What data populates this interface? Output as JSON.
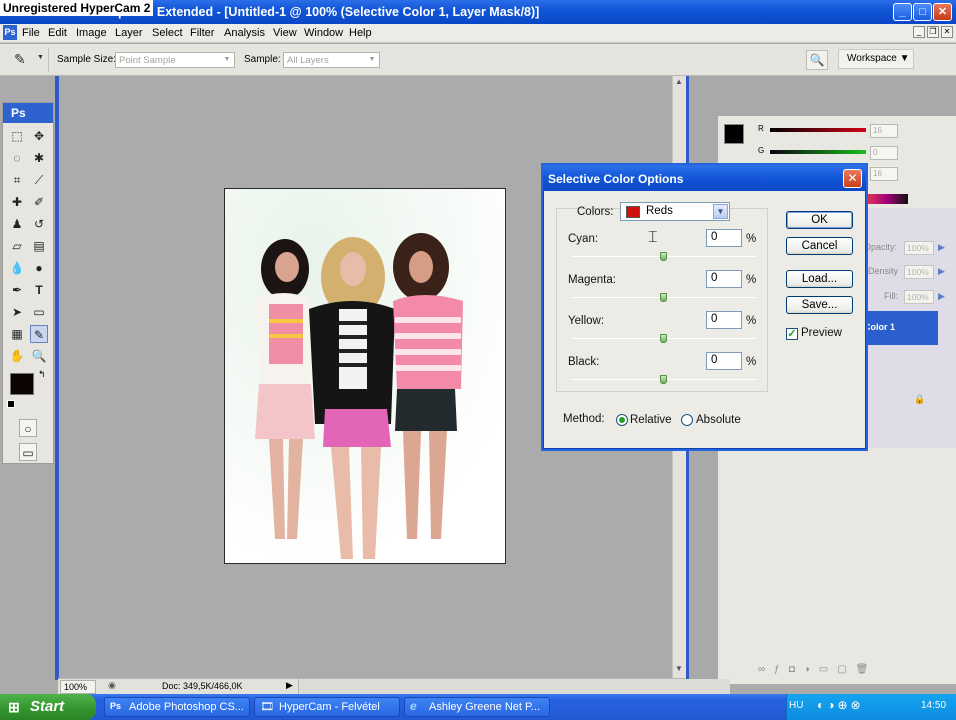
{
  "overlay": {
    "recorder": "Unregistered HyperCam 2"
  },
  "window": {
    "title": "Adobe Photoshop CS3 Extended - [Untitled-1 @ 100% (Selective Color 1, Layer Mask/8)]",
    "min": "_",
    "max": "□",
    "close": "✕"
  },
  "menu": [
    "File",
    "Edit",
    "Image",
    "Layer",
    "Select",
    "Filter",
    "Analysis",
    "View",
    "Window",
    "Help"
  ],
  "options": {
    "sample_size_label": "Sample Size:",
    "sample_size_value": "Point Sample",
    "sample_label": "Sample:",
    "sample_value": "All Layers",
    "workspace_label": "Workspace ▼"
  },
  "toolbox": {
    "logo": "Ps"
  },
  "panels": {
    "r_label": "R",
    "g_label": "G",
    "r_value": "16",
    "g_value": "0",
    "b_value": "16",
    "opacity_label": "Opacity:",
    "opacity_value": "100%",
    "density_label": "Density",
    "density_value": "100%",
    "fill_label": "Fill:",
    "fill_value": "100%",
    "layer_name": "Color 1"
  },
  "dialog": {
    "title": "Selective Color Options",
    "colors_label": "Colors:",
    "colors_value": "Reds",
    "swatch_color": "#d0100e",
    "sliders": [
      {
        "label": "Cyan:",
        "value": "0",
        "unit": "%",
        "level": 0
      },
      {
        "label": "Magenta:",
        "value": "0",
        "unit": "%",
        "level": 0
      },
      {
        "label": "Yellow:",
        "value": "0",
        "unit": "%",
        "level": 0
      },
      {
        "label": "Black:",
        "value": "0",
        "unit": "%",
        "level": 0
      }
    ],
    "ok": "OK",
    "cancel": "Cancel",
    "load": "Load...",
    "save": "Save...",
    "preview_label": "Preview",
    "preview_checked": true,
    "method_label": "Method:",
    "relative_label": "Relative",
    "absolute_label": "Absolute",
    "method_value": "Relative"
  },
  "status": {
    "zoom": "100%",
    "doc": "Doc: 349,5K/466,0K"
  },
  "taskbar": {
    "start": "Start",
    "tasks": [
      "Adobe Photoshop CS...",
      "HyperCam - Felvétel",
      "Ashley Greene Net P..."
    ],
    "lang": "HU",
    "clock": "14:50"
  }
}
